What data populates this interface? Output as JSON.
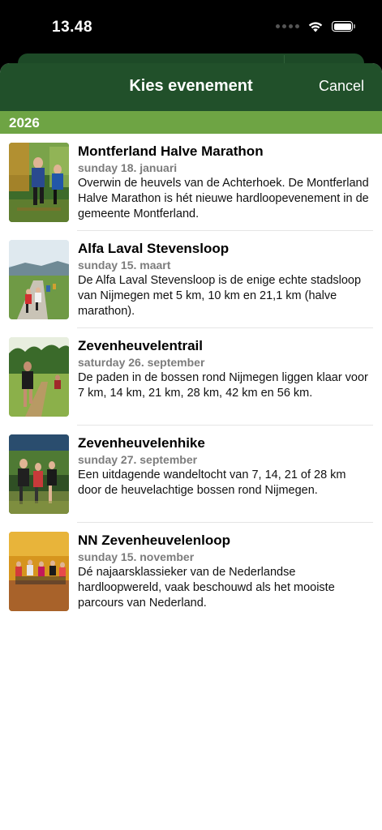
{
  "status": {
    "time": "13.48"
  },
  "nav": {
    "title": "Kies evenement",
    "cancel": "Cancel"
  },
  "section": {
    "year": "2026"
  },
  "events": [
    {
      "title": "Montferland Halve Marathon",
      "date": "sunday 18. januari",
      "description": "Overwin de heuvels van de Achterhoek. De Montferland Halve Marathon is hét nieuwe hardloopevenement in de gemeente Montferland."
    },
    {
      "title": "Alfa Laval Stevensloop",
      "date": "sunday 15. maart",
      "description": "De Alfa Laval Stevensloop is de enige echte stadsloop van Nijmegen met 5 km, 10 km en 21,1 km (halve marathon)."
    },
    {
      "title": "Zevenheuvelentrail",
      "date": "saturday 26. september",
      "description": "De paden in de bossen rond Nijmegen liggen klaar voor 7 km, 14 km, 21 km, 28 km, 42 km en 56 km."
    },
    {
      "title": "Zevenheuvelenhike",
      "date": "sunday 27. september",
      "description": "Een uitdagende wandeltocht van 7, 14, 21 of 28 km door de heuvelachtige bossen rond Nijmegen."
    },
    {
      "title": "NN Zevenheuvelenloop",
      "date": "sunday 15. november",
      "description": "Dé najaarsklassieker van de Nederlandse hardloopwereld, vaak beschouwd als het mooiste parcours van Nederland."
    }
  ]
}
